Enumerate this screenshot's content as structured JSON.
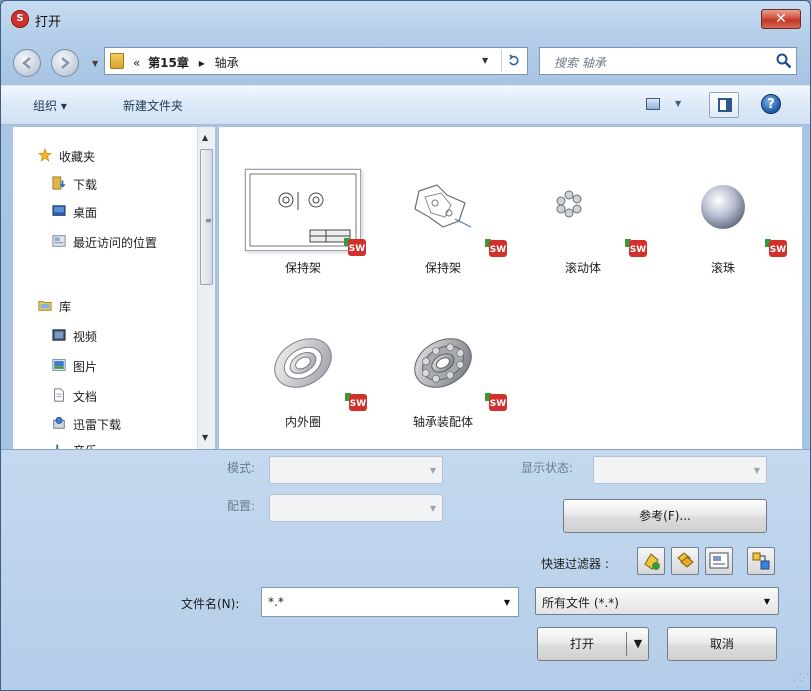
{
  "window": {
    "title": "打开",
    "close_label": "✕"
  },
  "nav": {
    "breadcrumb": [
      "«",
      "第15章",
      "▸",
      "轴承"
    ],
    "search_placeholder": "搜索 轴承"
  },
  "toolbar": {
    "organize": "组织 ▾",
    "new_folder": "新建文件夹"
  },
  "sidebar": {
    "favorites_header": "收藏夹",
    "favorites": [
      "下载",
      "桌面",
      "最近访问的位置"
    ],
    "library_header": "库",
    "libraries": [
      "视频",
      "图片",
      "文档",
      "迅雷下载",
      "音乐"
    ]
  },
  "files": [
    {
      "label": "保持架",
      "icon": "drawing-thumbnail"
    },
    {
      "label": "保持架",
      "icon": "assembly-thumbnail"
    },
    {
      "label": "滚动体",
      "icon": "rollers-thumbnail"
    },
    {
      "label": "滚珠",
      "icon": "sphere-thumbnail"
    },
    {
      "label": "内外圈",
      "icon": "ring-thumbnail"
    },
    {
      "label": "轴承装配体",
      "icon": "bearing-thumbnail"
    }
  ],
  "options": {
    "mode_label": "模式:",
    "config_label": "配置:",
    "display_state_label": "显示状态:",
    "references_button": "参考(F)...",
    "quick_filter_label": "快速过滤器 :"
  },
  "filename": {
    "label": "文件名(N):",
    "value": "*.*"
  },
  "filetype": {
    "value": "所有文件 (*.*)"
  },
  "buttons": {
    "open": "打开",
    "open_dropdown": "▼",
    "cancel": "取消"
  },
  "colors": {
    "accent": "#d0312d",
    "frame": "#a9c5e3",
    "toolbar": "#dde9f7"
  }
}
